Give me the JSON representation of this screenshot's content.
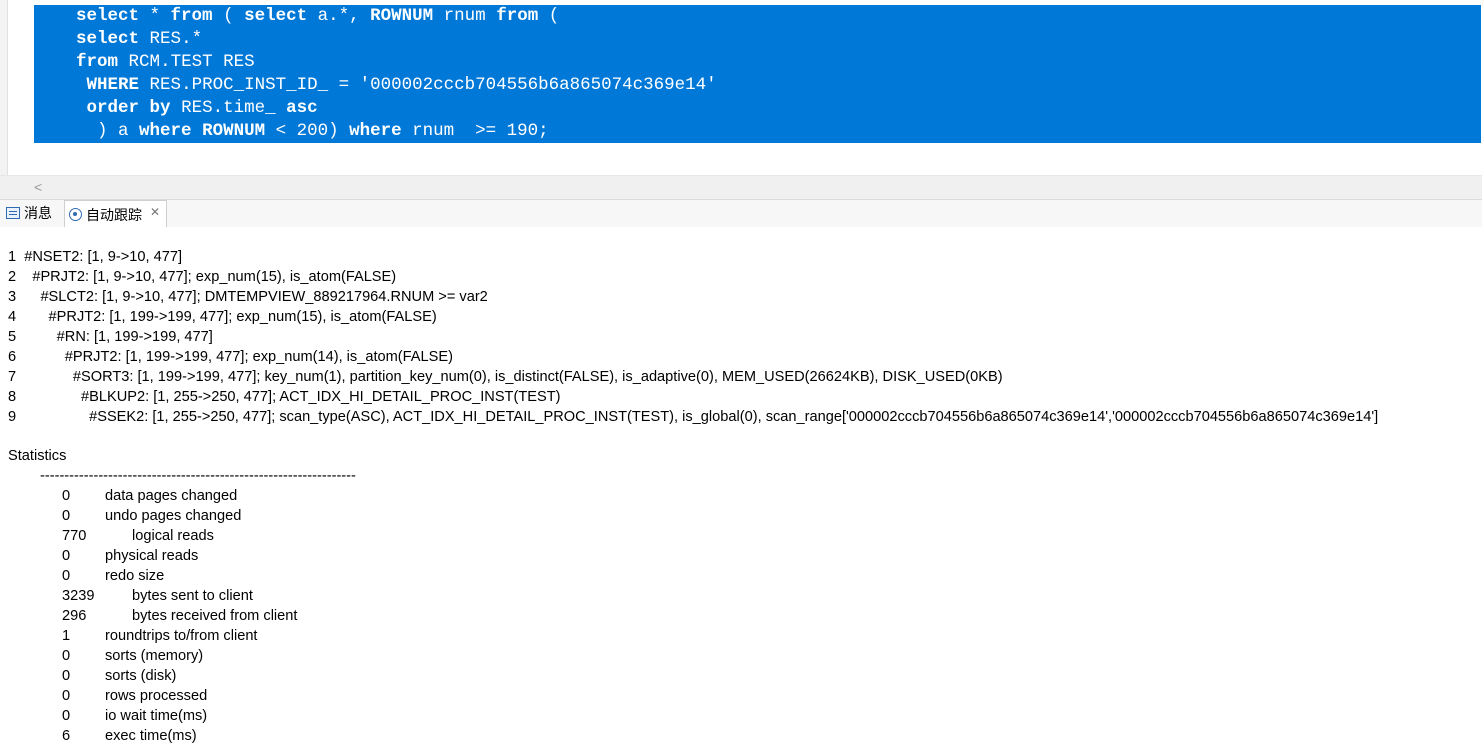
{
  "editor": {
    "lines": [
      {
        "text": "    select * from ( select a.*, ROWNUM rnum from (",
        "tail": ""
      },
      {
        "text": "    select RES.*",
        "tail": ""
      },
      {
        "text": "    from RCM.TEST RES",
        "tail": ""
      },
      {
        "text": "     WHERE RES.PROC_INST_ID_ = '000002cccb704556b6a865074c369e14'",
        "tail": ""
      },
      {
        "text": "     order by RES.time_ asc",
        "tail": ""
      },
      {
        "text": "      ) a where ROWNUM < 200) where rnum  >= 190;",
        "tail": ""
      }
    ]
  },
  "hscroll": {
    "left_arrow": "<"
  },
  "tabs": {
    "messages": "消息",
    "autotrace": "自动跟踪",
    "close": "✕"
  },
  "plan": [
    "1  #NSET2: [1, 9->10, 477]",
    "2    #PRJT2: [1, 9->10, 477]; exp_num(15), is_atom(FALSE)",
    "3      #SLCT2: [1, 9->10, 477]; DMTEMPVIEW_889217964.RNUM >= var2",
    "4        #PRJT2: [1, 199->199, 477]; exp_num(15), is_atom(FALSE)",
    "5          #RN: [1, 199->199, 477]",
    "6            #PRJT2: [1, 199->199, 477]; exp_num(14), is_atom(FALSE)",
    "7              #SORT3: [1, 199->199, 477]; key_num(1), partition_key_num(0), is_distinct(FALSE), is_adaptive(0), MEM_USED(26624KB), DISK_USED(0KB)",
    "8                #BLKUP2: [1, 255->250, 477]; ACT_IDX_HI_DETAIL_PROC_INST(TEST)",
    "9                  #SSEK2: [1, 255->250, 477]; scan_type(ASC), ACT_IDX_HI_DETAIL_PROC_INST(TEST), is_global(0), scan_range['000002cccb704556b6a865074c369e14','000002cccb704556b6a865074c369e14']"
  ],
  "statistics": {
    "title": "Statistics",
    "separator": "-----------------------------------------------------------------",
    "rows": [
      {
        "value": "0",
        "label": "data pages changed"
      },
      {
        "value": "0",
        "label": "undo pages changed"
      },
      {
        "value": "770",
        "label": "logical reads"
      },
      {
        "value": "0",
        "label": "physical reads"
      },
      {
        "value": "0",
        "label": "redo size"
      },
      {
        "value": "3239",
        "label": "bytes sent to client"
      },
      {
        "value": "296",
        "label": "bytes received from client"
      },
      {
        "value": "1",
        "label": "roundtrips to/from client"
      },
      {
        "value": "0",
        "label": "sorts (memory)"
      },
      {
        "value": "0",
        "label": "sorts (disk)"
      },
      {
        "value": "0",
        "label": "rows processed"
      },
      {
        "value": "0",
        "label": "io wait time(ms)"
      },
      {
        "value": "6",
        "label": "exec time(ms)"
      }
    ]
  },
  "colors": {
    "selection": "#0078d7"
  }
}
